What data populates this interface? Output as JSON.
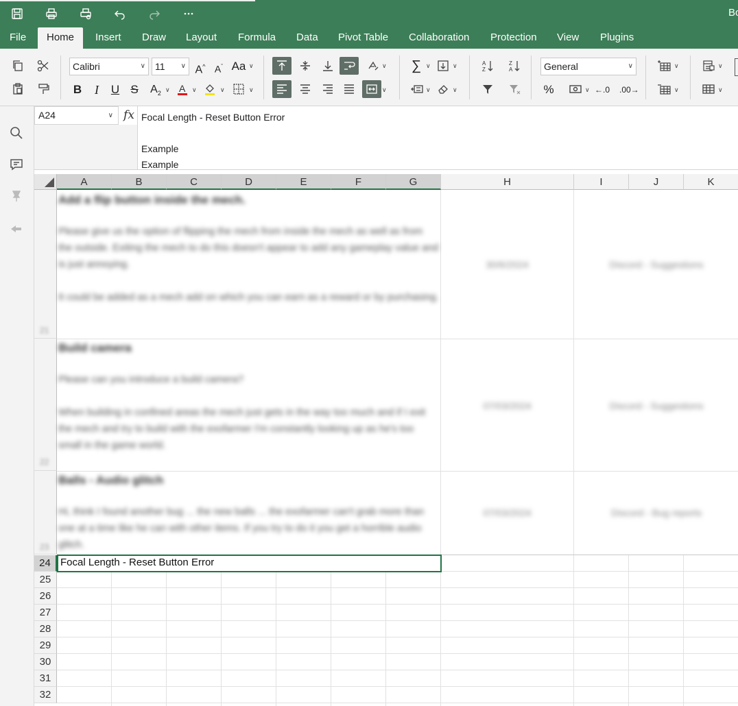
{
  "window": {
    "title_fragment": "Bo"
  },
  "menu": {
    "file": "File",
    "home": "Home",
    "insert": "Insert",
    "draw": "Draw",
    "layout": "Layout",
    "formula": "Formula",
    "data": "Data",
    "pivot_table": "Pivot Table",
    "collaboration": "Collaboration",
    "protection": "Protection",
    "view": "View",
    "plugins": "Plugins"
  },
  "ribbon": {
    "font_name": "Calibri",
    "font_size": "11",
    "number_format": "General",
    "bold": "B",
    "italic": "I",
    "underline": "U",
    "strike": "S",
    "percent": "%",
    "case_change": "Aa"
  },
  "formula_bar": {
    "cell_ref": "A24",
    "fx_label": "fx",
    "content": "Focal Length - Reset Button Error\n\nExample\nExample"
  },
  "grid": {
    "columns": [
      "A",
      "B",
      "C",
      "D",
      "E",
      "F",
      "G",
      "H",
      "I",
      "J",
      "K"
    ],
    "rows": [
      "24",
      "25",
      "26",
      "27",
      "28",
      "29",
      "30",
      "31",
      "32"
    ],
    "active_cell_text": "Focal Length - Reset Button Error",
    "blurred_rows": [
      {
        "num": "21",
        "title": "Add a flip button inside the mech.",
        "body1": "Please give us the option of flipping the mech from inside the mech as well as from the outside. Exiting the mech to do this doesn't appear to add any gameplay value and is just annoying.",
        "body2": "It could be added as a mech add on which you can earn as a reward or by purchasing.",
        "date": "30/6/2024",
        "source": "Discord - Suggestions"
      },
      {
        "num": "22",
        "title": "Build camera",
        "body1": "Please can you introduce a build camera?",
        "body2": "When building in confined areas the mech just gets in the way too much and if I exit the mech and try to build with the exofarmer I'm constantly looking up as he's too small in the game world.",
        "date": "07/03/2024",
        "source": "Discord - Suggestions"
      },
      {
        "num": "23",
        "title": "Balls - Audio glitch",
        "body1": "Hi, think I found another bug ... the new balls ... the exofarmer can't grab more than one at a time like he can with other items. If you try to do it you get a horrible audio glitch.",
        "date": "07/03/2024",
        "source": "Discord - Bug reports"
      }
    ]
  }
}
